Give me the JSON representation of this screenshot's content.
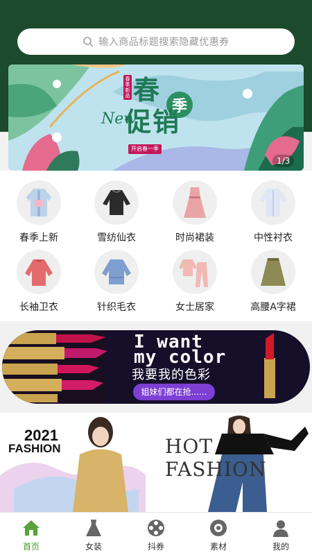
{
  "search": {
    "placeholder": "输入商品标题搜索隐藏优惠券"
  },
  "banner": {
    "title_line1": "春",
    "title_line2": "促销",
    "badge_char": "季",
    "new_text": "New",
    "counter": "1/3"
  },
  "categories": [
    {
      "label": "春季上新"
    },
    {
      "label": "雪纺仙衣"
    },
    {
      "label": "时尚裙装"
    },
    {
      "label": "中性衬衣"
    },
    {
      "label": "长袖卫衣"
    },
    {
      "label": "针织毛衣"
    },
    {
      "label": "女士居家"
    },
    {
      "label": "高腰A字裙"
    }
  ],
  "promo": {
    "line1": "I want",
    "line2": "my color",
    "line3": "我要我的色彩",
    "button": "姐妹们都在抢......"
  },
  "fashion": {
    "year": "2021",
    "left_label": "FASHION",
    "hot": "HOT",
    "right_label": "FASHION"
  },
  "tabs": [
    {
      "label": "首页",
      "icon": "home-icon",
      "active": true
    },
    {
      "label": "女装",
      "icon": "dress-icon"
    },
    {
      "label": "抖券",
      "icon": "film-reel-icon"
    },
    {
      "label": "素材",
      "icon": "camera-aperture-icon"
    },
    {
      "label": "我的",
      "icon": "user-icon"
    }
  ],
  "colors": {
    "header_green": "#1b4a2c",
    "active_tab": "#4c9a2a",
    "promo_bg": "#150f2a",
    "promo_button": "#7e3fd4"
  }
}
